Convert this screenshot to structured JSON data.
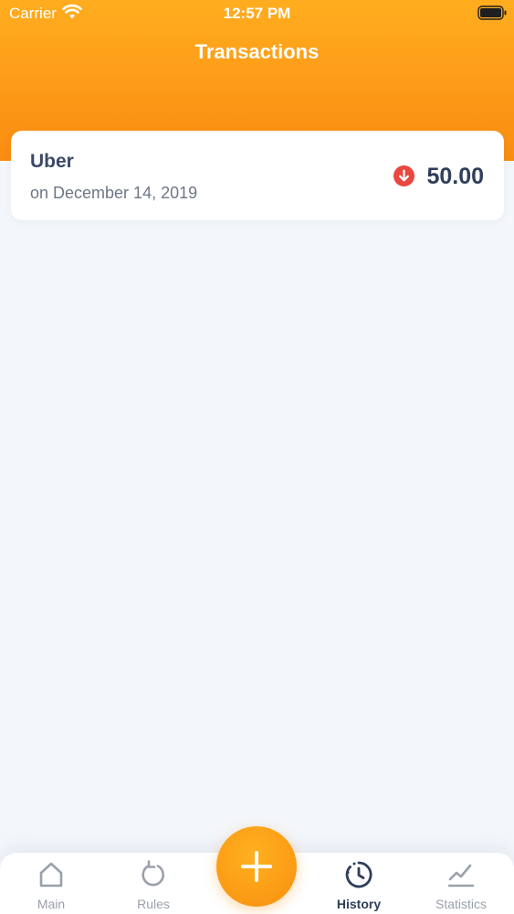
{
  "status_bar": {
    "carrier": "Carrier",
    "time": "12:57 PM"
  },
  "header": {
    "title": "Transactions"
  },
  "transactions": [
    {
      "name": "Uber",
      "date": "on December 14, 2019",
      "amount": "50.00",
      "direction": "down-arrow-icon"
    }
  ],
  "tabbar": {
    "tabs": [
      {
        "label": "Main",
        "icon": "home-icon",
        "active": false
      },
      {
        "label": "Rules",
        "icon": "refresh-icon",
        "active": false
      },
      {
        "label": "History",
        "icon": "clock-icon",
        "active": true
      },
      {
        "label": "Statistics",
        "icon": "chart-icon",
        "active": false
      }
    ],
    "fab_icon": "plus-icon"
  },
  "colors": {
    "accent": "#fd9a17",
    "expense": "#e9473f",
    "text_dark": "#2f3e5a",
    "background": "#f3f6fa"
  }
}
